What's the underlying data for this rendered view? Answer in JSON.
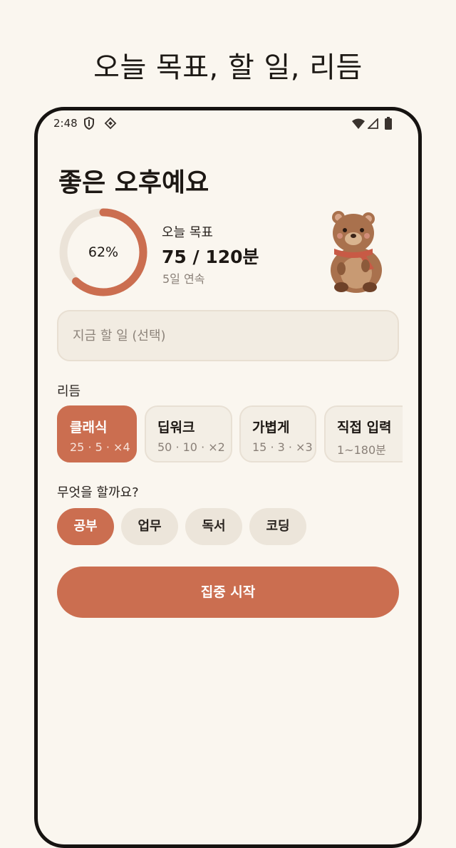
{
  "caption": "오늘 목표, 할 일, 리듬",
  "status_bar": {
    "time": "2:48",
    "icons": [
      "shield-icon",
      "diamond-icon",
      "wifi-icon",
      "signal-icon",
      "battery-icon"
    ]
  },
  "greeting": "좋은 오후예요",
  "goal": {
    "progress_label": "62%",
    "progress_fraction": 0.62,
    "label": "오늘 목표",
    "value": "75 / 120분",
    "streak": "5일 연속"
  },
  "task_input": {
    "placeholder": "지금 할 일 (선택)",
    "value": ""
  },
  "rhythm": {
    "label": "리듬",
    "options": [
      {
        "title": "클래식",
        "sub": "25 · 5 · ×4",
        "selected": true
      },
      {
        "title": "딥워크",
        "sub": "50 · 10 · ×2",
        "selected": false
      },
      {
        "title": "가볍게",
        "sub": "15 · 3 · ×3",
        "selected": false
      },
      {
        "title": "직접 입력",
        "sub": "1~180분",
        "selected": false
      }
    ]
  },
  "category": {
    "label": "무엇을 할까요?",
    "options": [
      {
        "label": "공부",
        "selected": true
      },
      {
        "label": "업무",
        "selected": false
      },
      {
        "label": "독서",
        "selected": false
      },
      {
        "label": "코딩",
        "selected": false
      }
    ]
  },
  "start_button": "집중 시작",
  "colors": {
    "accent": "#cb6e50",
    "background": "#faf6ef",
    "chip_bg": "#f3eee5",
    "ring_track": "#ebe3d8"
  }
}
